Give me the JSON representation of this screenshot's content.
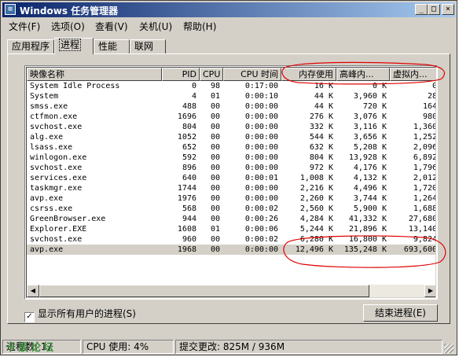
{
  "window": {
    "title": "Windows 任务管理器",
    "controls": {
      "minimize": "_",
      "maximize": "□",
      "close": "×"
    }
  },
  "menubar": [
    {
      "label": "文件(F)"
    },
    {
      "label": "选项(O)"
    },
    {
      "label": "查看(V)"
    },
    {
      "label": "关机(U)"
    },
    {
      "label": "帮助(H)"
    }
  ],
  "tabs": [
    {
      "label": "应用程序"
    },
    {
      "label": "进程"
    },
    {
      "label": "性能"
    },
    {
      "label": "联网"
    }
  ],
  "active_tab": "进程",
  "table": {
    "columns": [
      "映像名称",
      "PID",
      "CPU",
      "CPU 时间",
      "内存使用",
      "高峰内...",
      "虚拟内..."
    ],
    "rows": [
      [
        "System Idle Process",
        "0",
        "98",
        "0:17:00",
        "16 K",
        "0 K",
        "0"
      ],
      [
        "System",
        "4",
        "01",
        "0:00:10",
        "44 K",
        "3,960 K",
        "28"
      ],
      [
        "smss.exe",
        "488",
        "00",
        "0:00:00",
        "44 K",
        "720 K",
        "164"
      ],
      [
        "ctfmon.exe",
        "1696",
        "00",
        "0:00:00",
        "276 K",
        "3,076 K",
        "980"
      ],
      [
        "svchost.exe",
        "804",
        "00",
        "0:00:00",
        "332 K",
        "3,116 K",
        "1,360"
      ],
      [
        "alg.exe",
        "1052",
        "00",
        "0:00:00",
        "544 K",
        "3,656 K",
        "1,252"
      ],
      [
        "lsass.exe",
        "652",
        "00",
        "0:00:00",
        "632 K",
        "5,208 K",
        "2,096"
      ],
      [
        "winlogon.exe",
        "592",
        "00",
        "0:00:00",
        "804 K",
        "13,928 K",
        "6,892"
      ],
      [
        "svchost.exe",
        "896",
        "00",
        "0:00:00",
        "972 K",
        "4,176 K",
        "1,796"
      ],
      [
        "services.exe",
        "640",
        "00",
        "0:00:01",
        "1,008 K",
        "4,132 K",
        "2,012"
      ],
      [
        "taskmgr.exe",
        "1744",
        "00",
        "0:00:00",
        "2,216 K",
        "4,496 K",
        "1,720"
      ],
      [
        "avp.exe",
        "1976",
        "00",
        "0:00:00",
        "2,260 K",
        "3,744 K",
        "1,264"
      ],
      [
        "csrss.exe",
        "568",
        "00",
        "0:00:02",
        "2,560 K",
        "5,900 K",
        "1,688"
      ],
      [
        "GreenBrowser.exe",
        "944",
        "00",
        "0:00:26",
        "4,284 K",
        "41,332 K",
        "27,680"
      ],
      [
        "Explorer.EXE",
        "1608",
        "01",
        "0:00:06",
        "5,244 K",
        "21,896 K",
        "13,140"
      ],
      [
        "svchost.exe",
        "960",
        "00",
        "0:00:02",
        "6,280 K",
        "16,800 K",
        "9,824"
      ],
      [
        "avp.exe",
        "1968",
        "00",
        "0:00:00",
        "12,496 K",
        "135,248 K",
        "693,600"
      ]
    ],
    "selected_row": 16
  },
  "show_all_users": {
    "label": "显示所有用户的进程(S)",
    "checked": true
  },
  "end_process_label": "结束进程(E)",
  "statusbar": {
    "processes": "进程数: 17",
    "cpu": "CPU 使用: 4%",
    "commit": "提交更改: 825M / 936M"
  },
  "watermark": "卡饭论坛",
  "annotation_color": "#e00000"
}
